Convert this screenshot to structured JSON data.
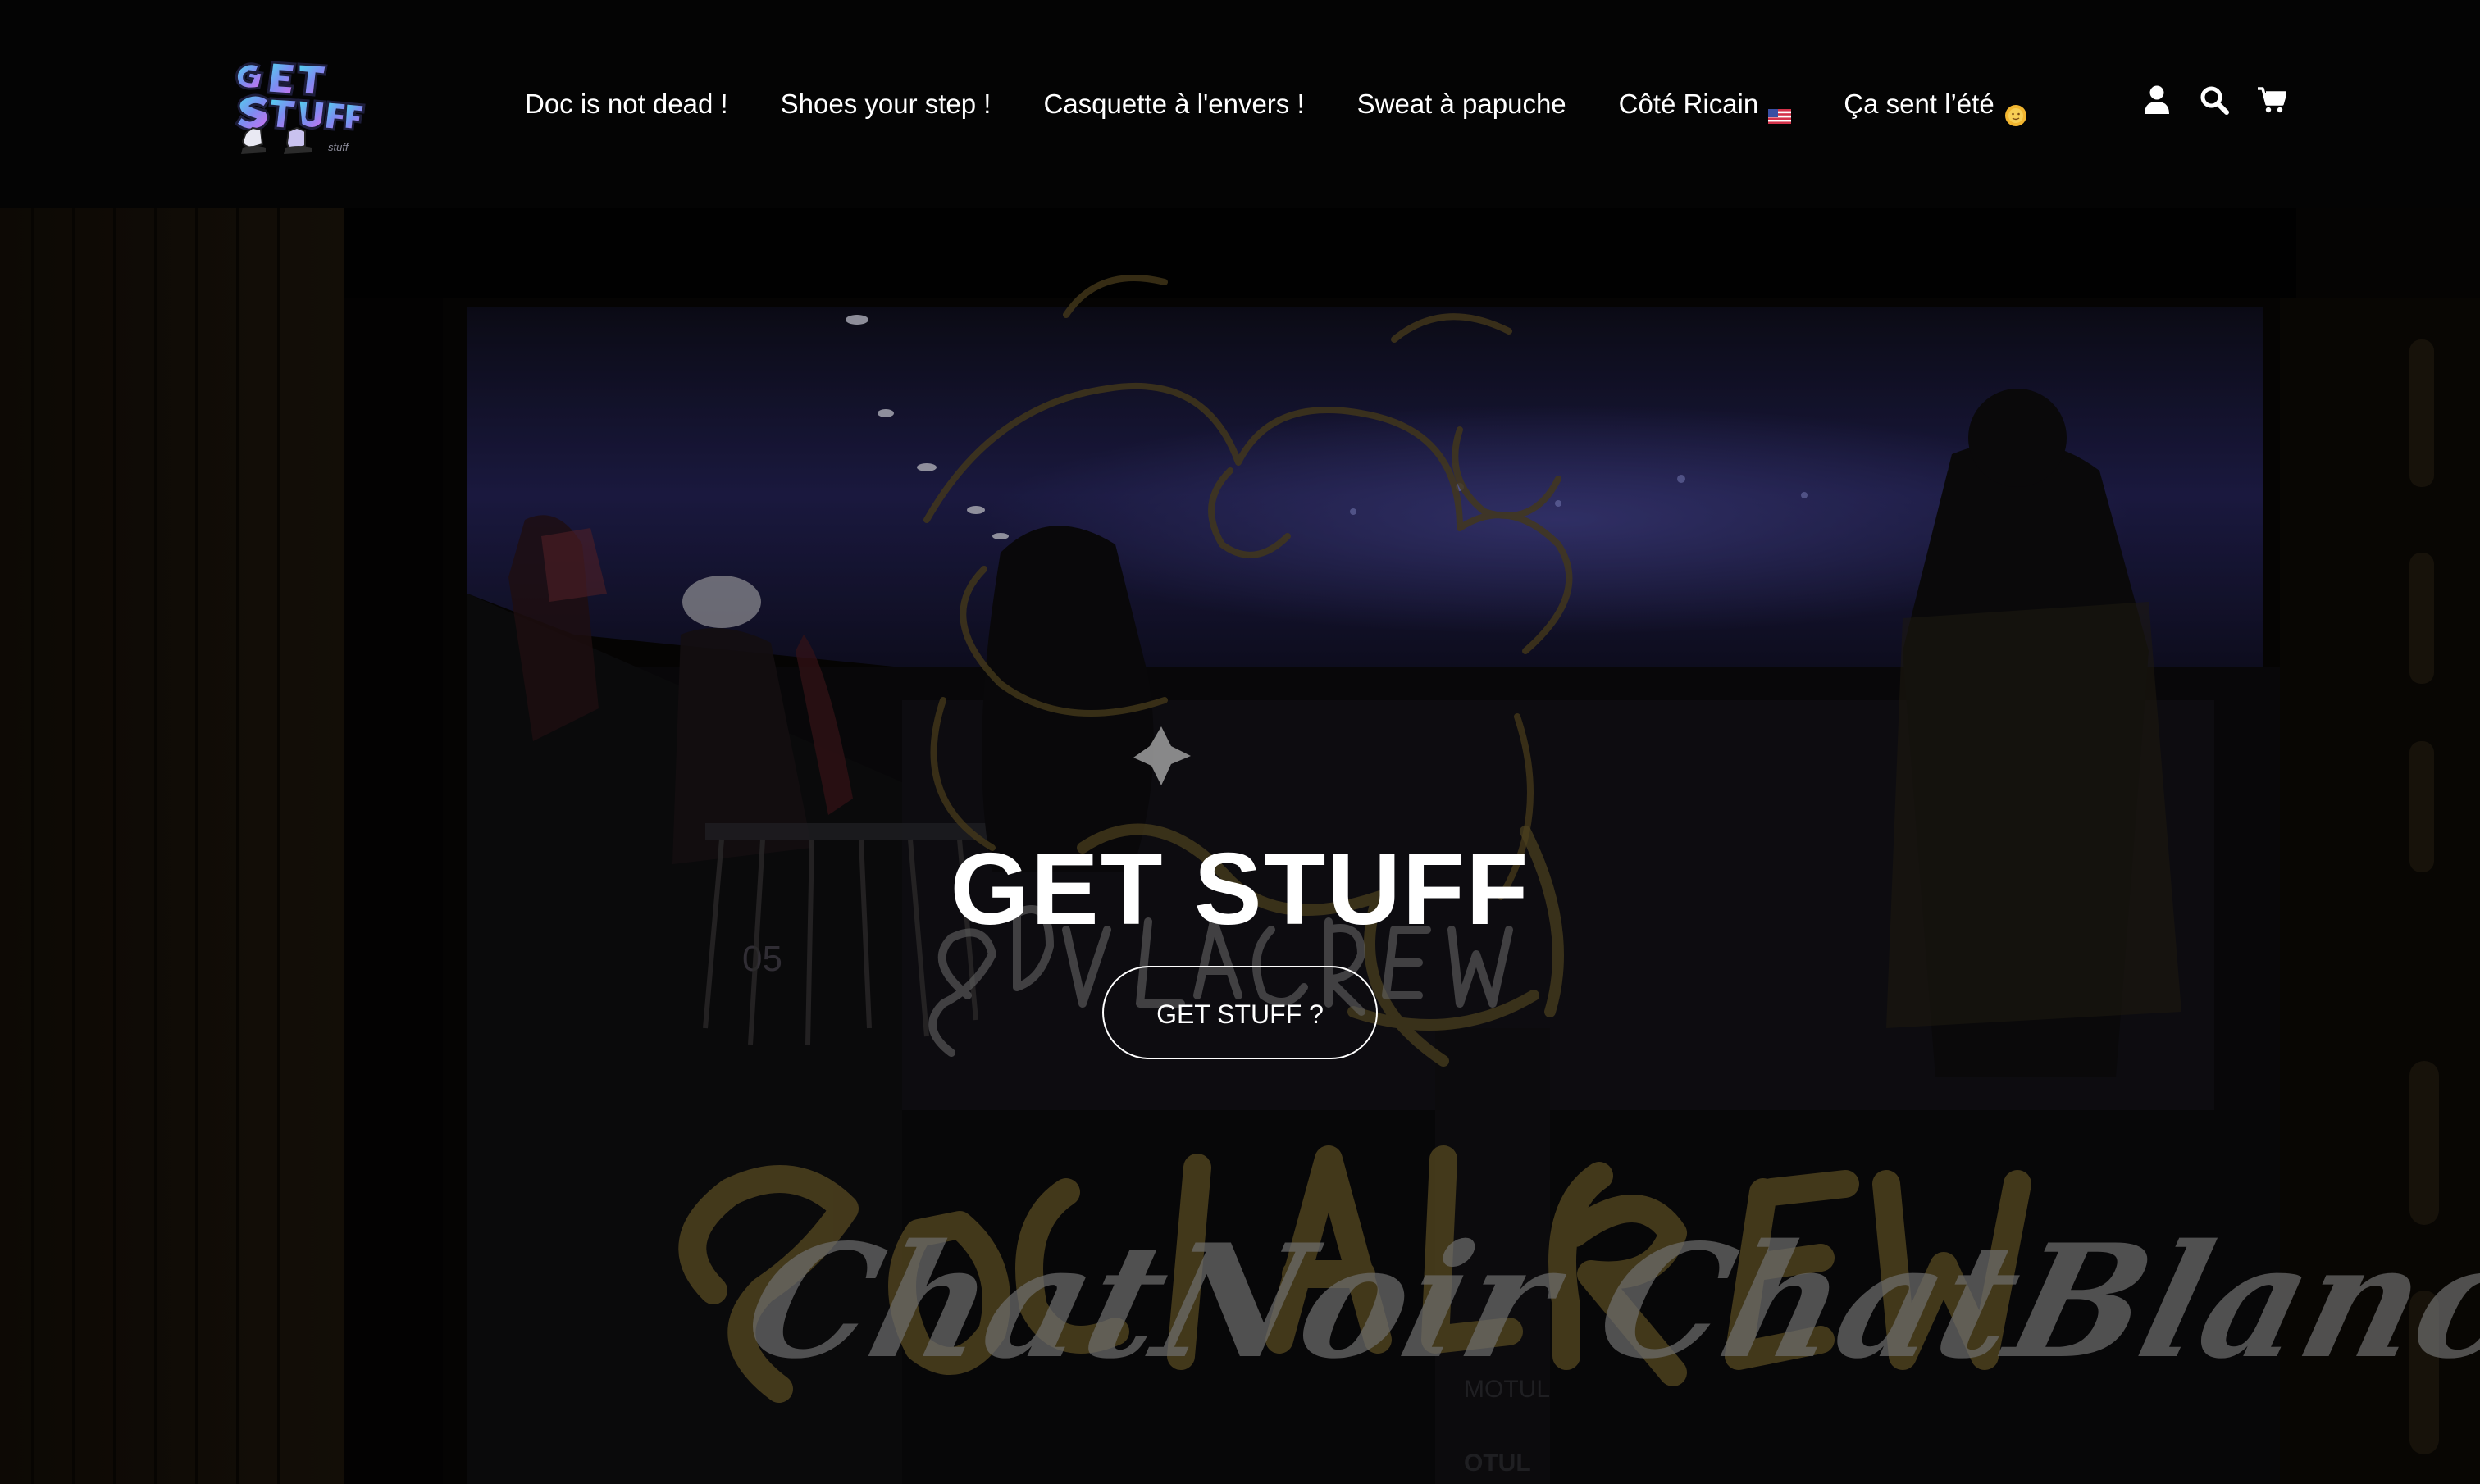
{
  "header": {
    "logo_text": "GET STUFF",
    "nav": [
      {
        "label": "Doc is not dead !"
      },
      {
        "label": "Shoes your step !"
      },
      {
        "label": "Casquette à l'envers !"
      },
      {
        "label": "Sweat à papuche"
      },
      {
        "label": "Côté Ricain",
        "emoji": "🇺🇸"
      },
      {
        "label": "Ça sent l’été",
        "emoji": "🌞"
      }
    ],
    "icons": [
      "account-icon",
      "search-icon",
      "cart-icon"
    ]
  },
  "hero": {
    "title": "GET STUFF",
    "button_label": "GET STUFF ?",
    "background_text": {
      "window_script": "ChatNoir ChatBlanc",
      "graffiti_top": "SOCIAL CREW",
      "graffiti_bottom": "SOCIAL CREW",
      "jersey_number": "05",
      "sign": "MOTUL"
    }
  },
  "colors": {
    "header_bg": "#040404",
    "text": "#ffffff",
    "graffiti_gold": "#6b5a2a",
    "ceiling_blue": "#3c3a8c"
  }
}
